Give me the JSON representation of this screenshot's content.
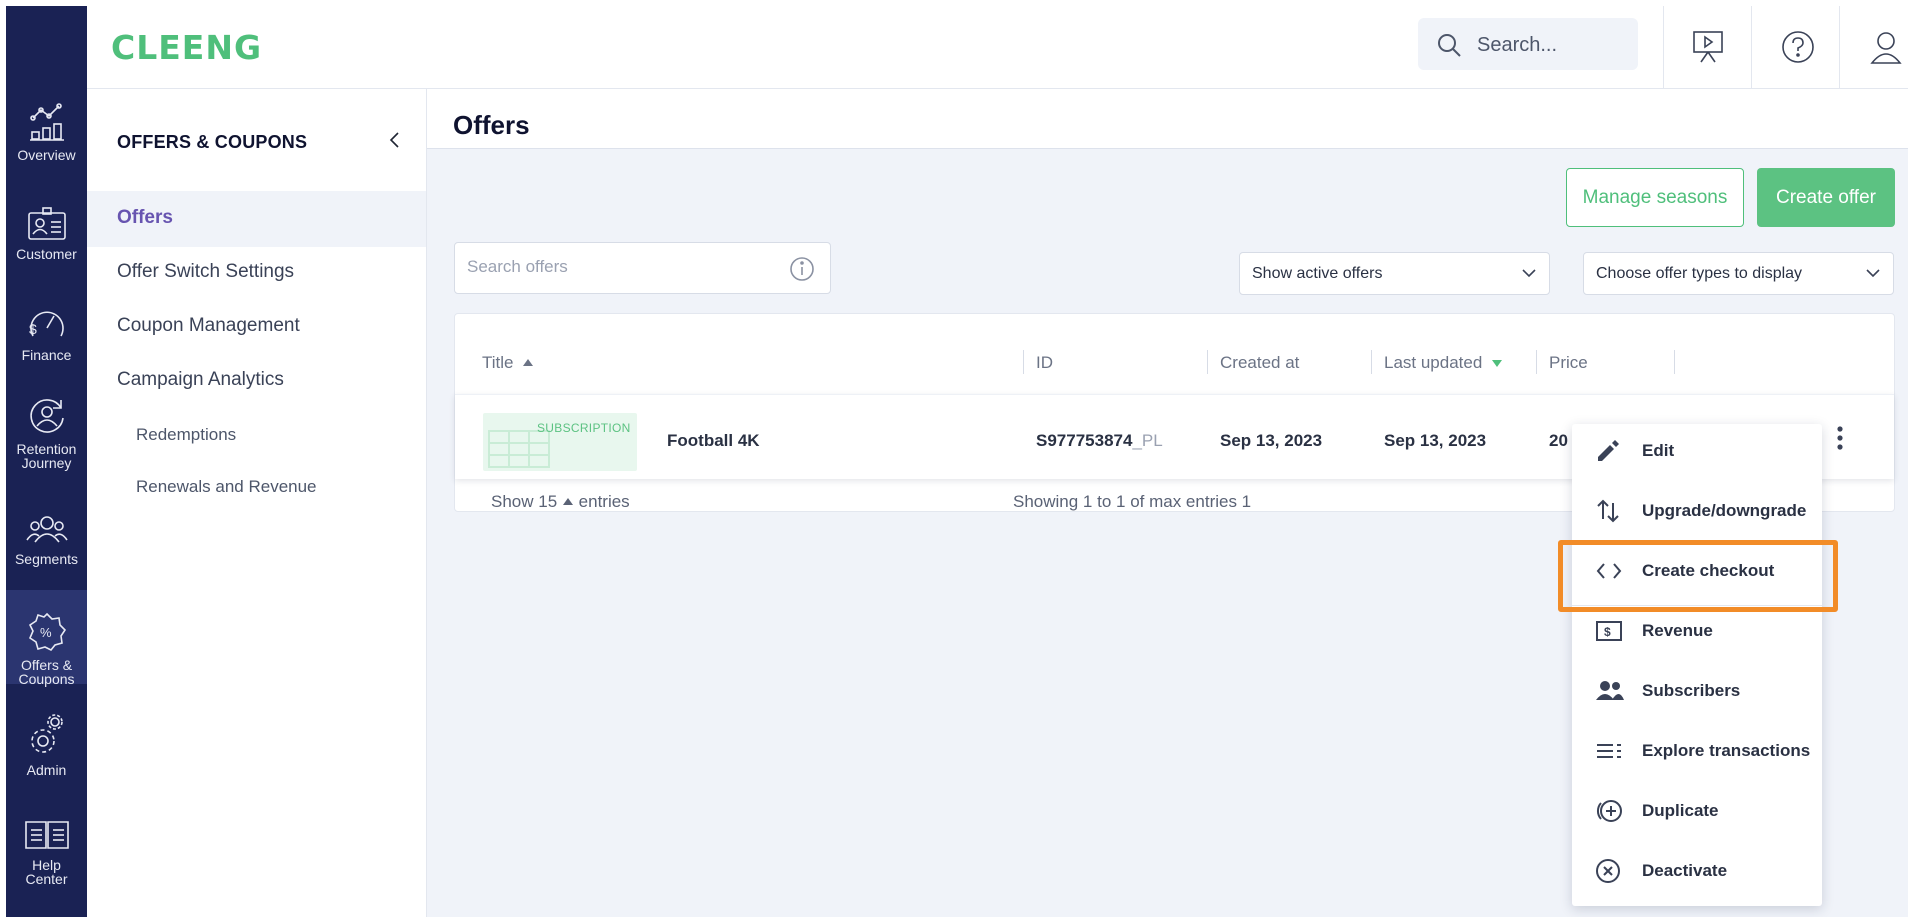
{
  "app": {
    "logo_text": "CLEENG",
    "brand_color": "#4fbf7b",
    "rail_color": "#1a2254"
  },
  "rail": {
    "items": [
      {
        "label": "Overview",
        "icon": "chart-line-icon"
      },
      {
        "label": "Customer",
        "icon": "id-card-icon"
      },
      {
        "label": "Finance",
        "icon": "gauge-dollar-icon"
      },
      {
        "label": "Retention Journey",
        "icon": "user-cycle-icon"
      },
      {
        "label": "Segments",
        "icon": "users-group-icon"
      },
      {
        "label": "Offers & Coupons",
        "icon": "percent-badge-icon",
        "active": true
      },
      {
        "label": "Admin",
        "icon": "gears-icon"
      },
      {
        "label": "Help Center",
        "icon": "book-icon"
      }
    ]
  },
  "topbar": {
    "search_placeholder": "Search...",
    "icons": [
      "presentation-play-icon",
      "help-circle-icon",
      "user-icon"
    ]
  },
  "subnav": {
    "title": "OFFERS & COUPONS",
    "items": [
      {
        "label": "Offers",
        "active": true
      },
      {
        "label": "Offer Switch Settings"
      },
      {
        "label": "Coupon Management"
      },
      {
        "label": "Campaign Analytics"
      }
    ],
    "subitems": [
      {
        "label": "Redemptions"
      },
      {
        "label": "Renewals and Revenue"
      }
    ]
  },
  "main": {
    "title": "Offers",
    "manage_seasons_label": "Manage seasons",
    "create_offer_label": "Create offer",
    "search_placeholder": "Search offers",
    "filter_status": "Show active offers",
    "filter_types": "Choose offer types to display"
  },
  "table": {
    "columns": [
      "Title",
      "ID",
      "Created at",
      "Last updated",
      "Price"
    ],
    "sort": {
      "title": "ascending",
      "last_updated": "descending"
    },
    "rows": [
      {
        "thumb_tag": "SUBSCRIPTION",
        "title": "Football 4K",
        "id_main": "S977753874",
        "id_suffix": "_PL",
        "created_at": "Sep 13, 2023",
        "last_updated": "Sep 13, 2023",
        "price": "20"
      }
    ],
    "footer": {
      "show_label": "Show",
      "page_size": "15",
      "entries_label": "entries",
      "summary": "Showing 1 to 1 of max entries 1"
    }
  },
  "context_menu": {
    "items": [
      {
        "label": "Edit",
        "icon": "pencil-icon"
      },
      {
        "label": "Upgrade/downgrade",
        "icon": "swap-vertical-icon"
      },
      {
        "label": "Create checkout",
        "icon": "code-brackets-icon",
        "highlighted": true
      },
      {
        "label": "Revenue",
        "icon": "dollar-bill-icon"
      },
      {
        "label": "Subscribers",
        "icon": "people-icon"
      },
      {
        "label": "Explore transactions",
        "icon": "list-icon"
      },
      {
        "label": "Duplicate",
        "icon": "plus-circle-icon"
      },
      {
        "label": "Deactivate",
        "icon": "x-circle-icon"
      }
    ],
    "highlight_color": "#f28c28"
  }
}
